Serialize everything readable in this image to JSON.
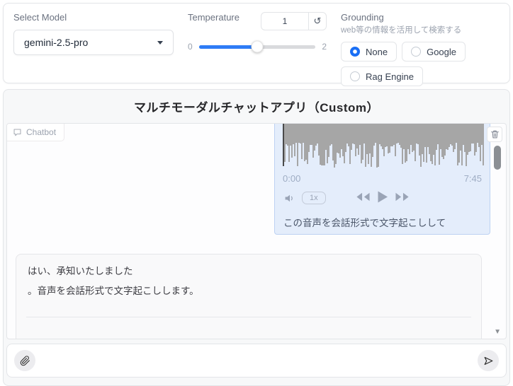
{
  "header": {
    "model": {
      "label": "Select Model",
      "value": "gemini-2.5-pro"
    },
    "temperature": {
      "label": "Temperature",
      "value": "1",
      "min": "0",
      "max": "2",
      "percent": 50
    },
    "grounding": {
      "label": "Grounding",
      "info": "web等の情報を活用して検索する",
      "options": [
        {
          "label": "None",
          "selected": true
        },
        {
          "label": "Google",
          "selected": false
        },
        {
          "label": "Rag Engine",
          "selected": false
        }
      ]
    }
  },
  "app": {
    "title": "マルチモーダルチャットアプリ（Custom）"
  },
  "chatbot": {
    "label": "Chatbot",
    "user_message": {
      "audio": {
        "current_time": "0:00",
        "duration": "7:45",
        "speed": "1x"
      },
      "text": "この音声を会話形式で文字起こしして"
    },
    "bot_message": {
      "text_line1": "はい、承知いたしました",
      "text_line2": "。音声を会話形式で文字起こしします。"
    }
  },
  "icons": {
    "reset": "↺",
    "scroll_down_arrow": "▼"
  },
  "colors": {
    "accent_blue": "#2e7cf6",
    "radio_selected_blue": "#1a6ff5",
    "user_bubble_bg": "#e4edfb",
    "user_bubble_border": "#bdd2f3",
    "waveform_gray": "#a6a6a6",
    "panel_border": "#e3e5e8",
    "main_panel_bg": "#f7f8f9"
  }
}
